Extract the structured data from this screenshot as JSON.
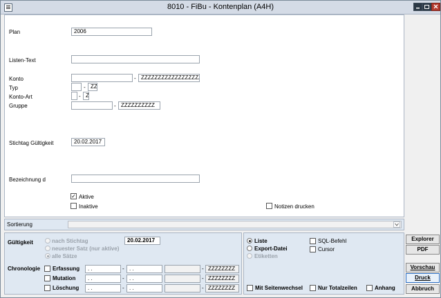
{
  "window": {
    "title": "8010 - FiBu - Kontenplan (A4H)"
  },
  "form": {
    "plan": {
      "label": "Plan",
      "value": "2006"
    },
    "listen_text": {
      "label": "Listen-Text",
      "value": ""
    },
    "konto": {
      "label": "Konto",
      "from": "",
      "to": "ZZZZZZZZZZZZZZZZZZZZ"
    },
    "typ": {
      "label": "Typ",
      "from": "",
      "to": "ZZ"
    },
    "konto_art": {
      "label": "Konto-Art",
      "from": "",
      "to": "Z"
    },
    "gruppe": {
      "label": "Gruppe",
      "from": "",
      "to": "ZZZZZZZZZZ"
    },
    "stichtag": {
      "label": "Stichtag Gültigkeit",
      "value": "20.02.2017"
    },
    "bezeichnung": {
      "label": "Bezeichnung d",
      "value": ""
    },
    "aktive": {
      "label": "Aktive",
      "checked": true
    },
    "inaktive": {
      "label": "Inaktive",
      "checked": false
    },
    "notizen": {
      "label": "Notizen drucken",
      "checked": false
    },
    "dash": "-"
  },
  "sortierung": {
    "label": "Sortierung",
    "value": ""
  },
  "gueltigkeit": {
    "label": "Gültigkeit",
    "nach_stichtag": "nach Stichtag",
    "neuester_satz": "neuester Satz (nur aktive)",
    "alle_saetze": "alle Sätze",
    "date": "20.02.2017"
  },
  "chronologie": {
    "label": "Chronologie",
    "rows": [
      {
        "label": "Erfassung",
        "d1": ". .",
        "d2": ". .",
        "t1": "",
        "t2": "ZZZZZZZZ"
      },
      {
        "label": "Mutation",
        "d1": ". .",
        "d2": ". .",
        "t1": "",
        "t2": "ZZZZZZZZ"
      },
      {
        "label": "Löschung",
        "d1": ". .",
        "d2": ". .",
        "t1": "",
        "t2": "ZZZZZZZZ"
      }
    ]
  },
  "output": {
    "liste": "Liste",
    "export": "Export-Datei",
    "etiketten": "Etiketten",
    "sql": "SQL-Befehl",
    "cursor": "Cursor",
    "seitenwechsel": "Mit Seitenwechsel",
    "totalzeilen": "Nur Totalzeilen",
    "anhang": "Anhang"
  },
  "buttons": {
    "explorer": "Explorer",
    "pdf": "PDF",
    "vorschau": "Vorschau",
    "druck": "Druck",
    "abbruch": "Abbruch"
  },
  "check_glyph": "✓"
}
